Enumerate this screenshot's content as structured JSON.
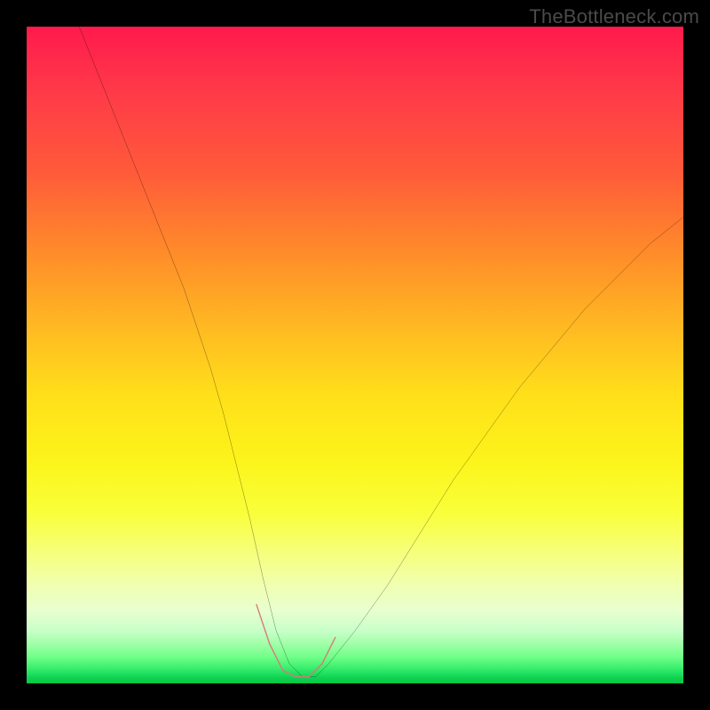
{
  "watermark": "TheBottleneck.com",
  "chart_data": {
    "type": "line",
    "title": "",
    "xlabel": "",
    "ylabel": "",
    "xlim": [
      0,
      100
    ],
    "ylim": [
      0,
      100
    ],
    "grid": false,
    "legend": null,
    "series": [
      {
        "name": "curve",
        "stroke": "#000000",
        "x": [
          8,
          12,
          16,
          20,
          24,
          28,
          30,
          32,
          34,
          36,
          38,
          40,
          42,
          44,
          46,
          50,
          55,
          60,
          65,
          70,
          75,
          80,
          85,
          90,
          95,
          100
        ],
        "y": [
          100,
          90,
          80,
          70,
          60,
          48,
          41,
          33,
          25,
          16,
          8,
          3,
          1,
          1,
          3,
          8,
          15,
          23,
          31,
          38,
          45,
          51,
          57,
          62,
          67,
          71
        ]
      },
      {
        "name": "highlight-segment",
        "stroke": "#d97a7a",
        "x": [
          35,
          37,
          39,
          41,
          43,
          45,
          47
        ],
        "y": [
          12,
          6,
          2,
          1,
          1,
          3,
          7
        ]
      }
    ],
    "background_gradient": {
      "orientation": "vertical",
      "stops": [
        {
          "pos": 0.0,
          "color": "#ff1a4d"
        },
        {
          "pos": 0.5,
          "color": "#ffd91a"
        },
        {
          "pos": 0.78,
          "color": "#f9ff3a"
        },
        {
          "pos": 0.96,
          "color": "#70ff88"
        },
        {
          "pos": 1.0,
          "color": "#08c848"
        }
      ]
    }
  }
}
